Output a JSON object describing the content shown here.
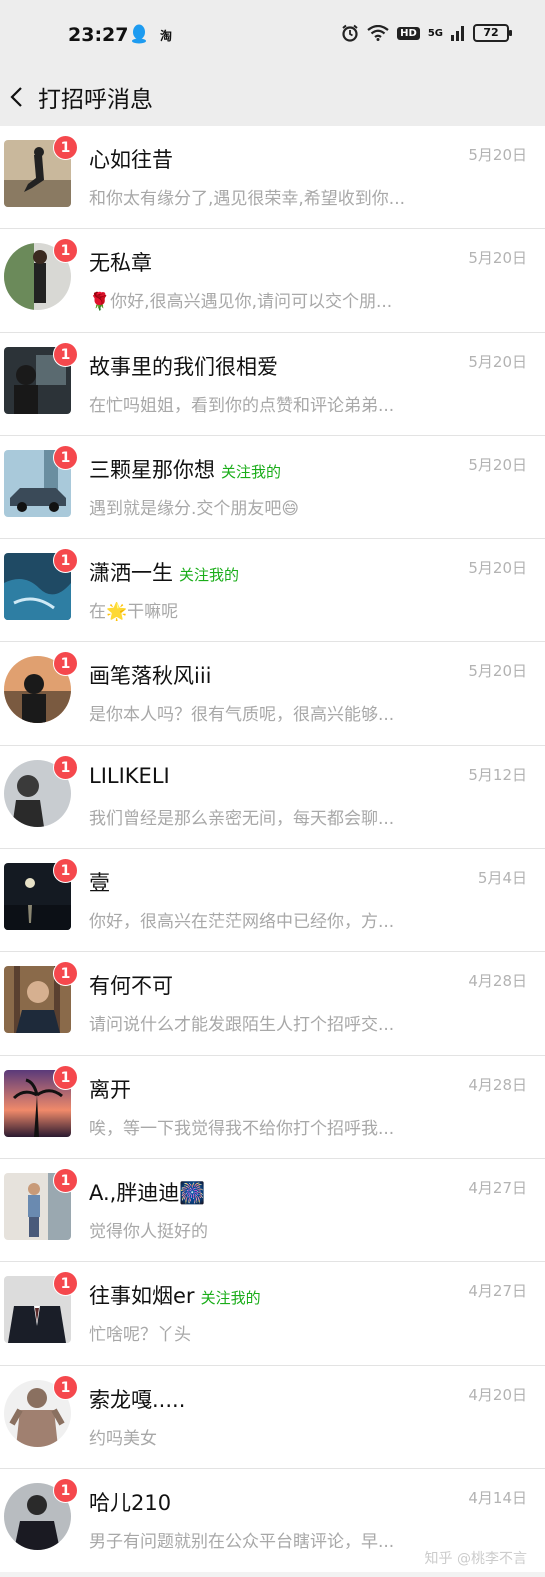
{
  "status_bar": {
    "time": "23:27",
    "taobao_label": "淘",
    "hd_label": "HD",
    "signal_label": "5G",
    "battery": "72"
  },
  "nav": {
    "title": "打招呼消息"
  },
  "colors": {
    "badge": "#f5484d",
    "follow": "#1aad19",
    "secondary_text": "#a8a8a8"
  },
  "items": [
    {
      "name": "心如往昔",
      "follow": "",
      "date": "5月20日",
      "message": "和你太有缘分了,遇见很荣幸,希望收到你...",
      "badge": "1"
    },
    {
      "name": "无私章",
      "follow": "",
      "date": "5月20日",
      "message": "🌹你好,很高兴遇见你,请问可以交个朋...",
      "badge": "1"
    },
    {
      "name": "故事里的我们很相爱",
      "follow": "",
      "date": "5月20日",
      "message": "在忙吗姐姐，看到你的点赞和评论弟弟...",
      "badge": "1"
    },
    {
      "name": "三颗星那你想",
      "follow": "关注我的",
      "date": "5月20日",
      "message": "遇到就是缘分.交个朋友吧😄",
      "badge": "1"
    },
    {
      "name": "潇洒一生",
      "follow": "关注我的",
      "date": "5月20日",
      "message": "在🌟干嘛呢",
      "badge": "1"
    },
    {
      "name": "画笔落秋风iii",
      "follow": "",
      "date": "5月20日",
      "message": "是你本人吗？很有气质呢，很高兴能够...",
      "badge": "1"
    },
    {
      "name": "LILIKELI",
      "follow": "",
      "date": "5月12日",
      "message": "我们曾经是那么亲密无间，每天都会聊...",
      "badge": "1"
    },
    {
      "name": "壹",
      "follow": "",
      "date": "5月4日",
      "message": "你好，很高兴在茫茫网络中已经你，方...",
      "badge": "1"
    },
    {
      "name": "有何不可",
      "follow": "",
      "date": "4月28日",
      "message": "请问说什么才能发跟陌生人打个招呼交...",
      "badge": "1"
    },
    {
      "name": "离开",
      "follow": "",
      "date": "4月28日",
      "message": "唉，等一下我觉得我不给你打个招呼我...",
      "badge": "1"
    },
    {
      "name": "A.,胖迪迪🎆",
      "follow": "",
      "date": "4月27日",
      "message": "觉得你人挺好的",
      "badge": "1"
    },
    {
      "name": "往事如烟er",
      "follow": "关注我的",
      "date": "4月27日",
      "message": "忙啥呢？丫头",
      "badge": "1"
    },
    {
      "name": "索龙嘎.....",
      "follow": "",
      "date": "4月20日",
      "message": "约吗美女",
      "badge": "1"
    },
    {
      "name": "哈儿210",
      "follow": "",
      "date": "4月14日",
      "message": "男子有问题就别在公众平台瞎评论，早...",
      "badge": "1"
    }
  ],
  "watermark": "知乎 @桃李不言"
}
